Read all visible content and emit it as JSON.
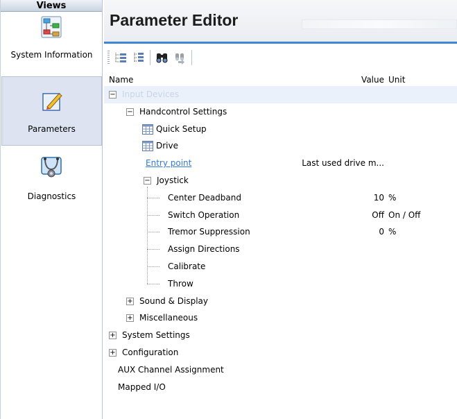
{
  "views": {
    "header": "Views",
    "items": [
      {
        "label": "System Information",
        "icon": "system-information-icon"
      },
      {
        "label": "Parameters",
        "icon": "parameters-icon"
      },
      {
        "label": "Diagnostics",
        "icon": "diagnostics-icon"
      }
    ]
  },
  "editor": {
    "title": "Parameter Editor",
    "toolbar": {
      "buttons": [
        "expand-all-icon",
        "collapse-all-icon",
        "find-icon",
        "find-next-icon"
      ]
    },
    "columns": {
      "name": "Name",
      "value": "Value",
      "unit": "Unit"
    },
    "rows": [
      {
        "name": "Input Devices",
        "value": "",
        "unit": "",
        "expander": "−"
      },
      {
        "name": "Handcontrol Settings",
        "value": "",
        "unit": "",
        "expander": "−"
      },
      {
        "name": "Quick Setup",
        "value": "",
        "unit": ""
      },
      {
        "name": "Drive",
        "value": "",
        "unit": ""
      },
      {
        "name": "Entry point",
        "value": "Last used drive m...",
        "unit": ""
      },
      {
        "name": "Joystick",
        "value": "",
        "unit": "",
        "expander": "−"
      },
      {
        "name": "Center Deadband",
        "value": "10",
        "unit": "%"
      },
      {
        "name": "Switch Operation",
        "value": "Off",
        "unit": "On / Off"
      },
      {
        "name": "Tremor Suppression",
        "value": "0",
        "unit": "%"
      },
      {
        "name": "Assign Directions",
        "value": "",
        "unit": ""
      },
      {
        "name": "Calibrate",
        "value": "",
        "unit": ""
      },
      {
        "name": "Throw",
        "value": "",
        "unit": ""
      },
      {
        "name": "Sound & Display",
        "value": "",
        "unit": "",
        "expander": "+"
      },
      {
        "name": "Miscellaneous",
        "value": "",
        "unit": "",
        "expander": "+"
      },
      {
        "name": "System Settings",
        "value": "",
        "unit": "",
        "expander": "+"
      },
      {
        "name": "Configuration",
        "value": "",
        "unit": "",
        "expander": "+"
      },
      {
        "name": "AUX Channel Assignment",
        "value": "",
        "unit": ""
      },
      {
        "name": "Mapped I/O",
        "value": "",
        "unit": ""
      }
    ]
  },
  "colors": {
    "accent": "#3c86d6",
    "link": "#2f7bd6",
    "selected_panel": "#dde3f0"
  }
}
